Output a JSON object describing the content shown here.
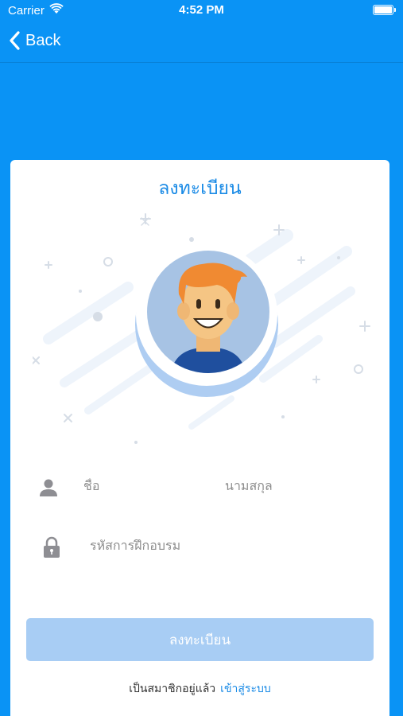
{
  "status_bar": {
    "carrier": "Carrier",
    "time": "4:52 PM"
  },
  "nav": {
    "back_label": "Back"
  },
  "card": {
    "title": "ลงทะเบียน"
  },
  "form": {
    "first_name_placeholder": "ชื่อ",
    "last_name_placeholder": "นามสกุล",
    "training_code_placeholder": "รหัสการฝึกอบรม"
  },
  "register_button": {
    "label": "ลงทะเบียน"
  },
  "footer": {
    "prompt": "เป็นสมาชิกอยู่แล้ว",
    "login_link": "เข้าสู่ระบบ"
  },
  "colors": {
    "background": "#0a93f5",
    "accent": "#1b8be6",
    "button_disabled": "#a8cdf4"
  }
}
